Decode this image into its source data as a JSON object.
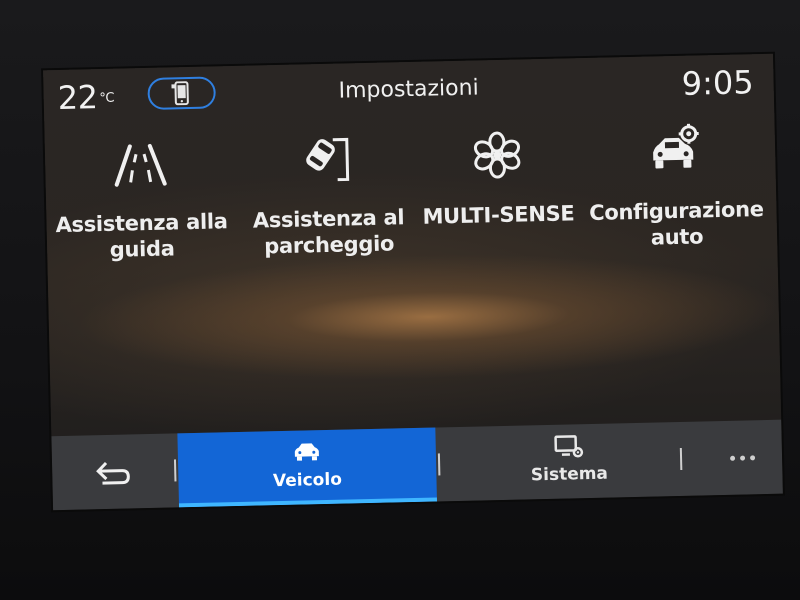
{
  "status_bar": {
    "temperature": "22",
    "temperature_unit": "°C",
    "title": "Impostazioni",
    "time": "9:05"
  },
  "tiles": [
    {
      "label_line1": "Assistenza alla",
      "label_line2": "guida",
      "icon": "driving-assist-road-icon"
    },
    {
      "label_line1": "Assistenza al",
      "label_line2": "parcheggio",
      "icon": "parking-assist-icon"
    },
    {
      "label_line1": "MULTI-SENSE",
      "label_line2": "",
      "icon": "multi-sense-flower-icon"
    },
    {
      "label_line1": "Configurazione",
      "label_line2": "auto",
      "icon": "car-settings-icon"
    }
  ],
  "bottom_bar": {
    "tabs": [
      {
        "label": "Veicolo",
        "icon": "car-icon",
        "active": true
      },
      {
        "label": "Sistema",
        "icon": "system-monitor-gear-icon",
        "active": false
      }
    ],
    "back_icon": "back-arrow-icon",
    "more_icon": "more-dots-icon"
  },
  "colors": {
    "accent_blue": "#1366d6",
    "active_underline": "#3fb6ff",
    "phone_pill_border": "#2f7fe0",
    "bar_background": "#3a3b3e"
  }
}
